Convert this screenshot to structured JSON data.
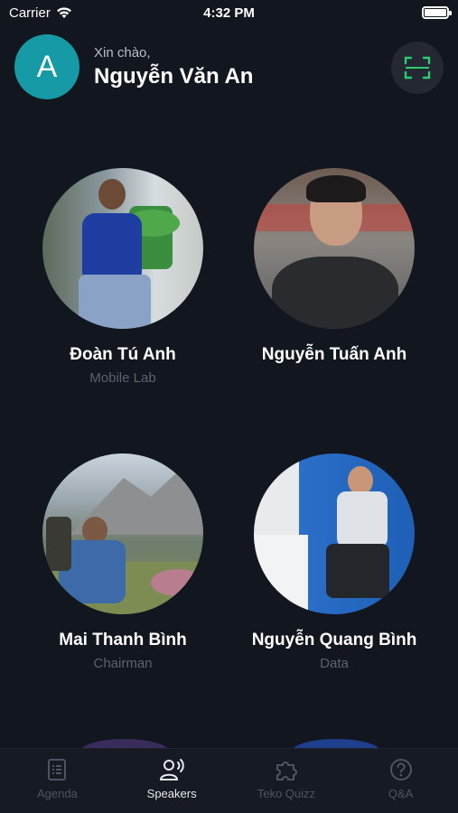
{
  "status_bar": {
    "carrier": "Carrier",
    "time": "4:32 PM",
    "battery_level": 1.0
  },
  "header": {
    "avatar_initial": "A",
    "greeting": "Xin chào,",
    "user_name": "Nguyễn Văn An",
    "scan_icon": "qr-scan-icon"
  },
  "speakers": [
    {
      "name": "Đoàn Tú Anh",
      "role": "Mobile Lab"
    },
    {
      "name": "Nguyễn Tuấn Anh",
      "role": ""
    },
    {
      "name": "Mai Thanh Bình",
      "role": "Chairman"
    },
    {
      "name": "Nguyễn Quang Bình",
      "role": "Data"
    }
  ],
  "tabs": [
    {
      "label": "Agenda",
      "icon": "agenda-list-icon",
      "active": false
    },
    {
      "label": "Speakers",
      "icon": "speaker-icon",
      "active": true
    },
    {
      "label": "Teko Quizz",
      "icon": "puzzle-icon",
      "active": false
    },
    {
      "label": "Q&A",
      "icon": "question-icon",
      "active": false
    }
  ],
  "colors": {
    "background": "#12161f",
    "avatar": "#159aa6",
    "scan_accent": "#2ecc71"
  }
}
